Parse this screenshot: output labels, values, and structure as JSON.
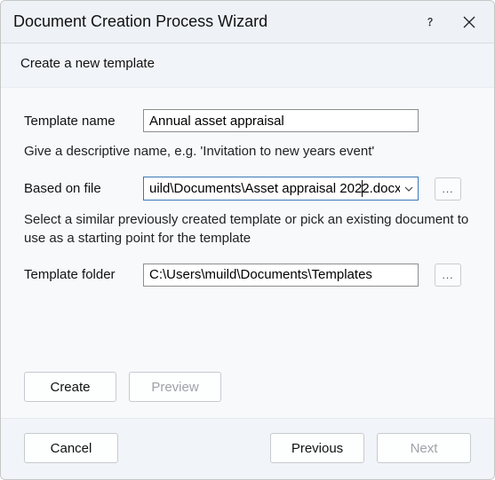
{
  "window": {
    "title": "Document Creation Process Wizard"
  },
  "subtitle": "Create a new template",
  "fields": {
    "name": {
      "label": "Template name",
      "value": "Annual asset appraisal",
      "helper": "Give a descriptive name, e.g. 'Invitation to new years event'"
    },
    "basedOn": {
      "label": "Based on file",
      "value": "uild\\Documents\\Asset appraisal 2022.docx",
      "browseLabel": "...",
      "helper": "Select a similar previously created template or pick an existing document to use as a starting point for the template"
    },
    "folder": {
      "label": "Template folder",
      "value": "C:\\Users\\muild\\Documents\\Templates",
      "browseLabel": "..."
    }
  },
  "buttons": {
    "create": "Create",
    "preview": "Preview",
    "cancel": "Cancel",
    "previous": "Previous",
    "next": "Next"
  }
}
